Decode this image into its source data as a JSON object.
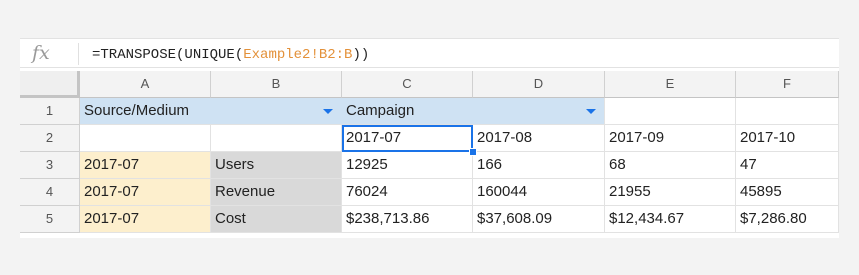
{
  "formula_bar": {
    "fx_label": "fx",
    "formula_prefix": "=TRANSPOSE(UNIQUE(",
    "formula_ref": "Example2!B2:B",
    "formula_suffix": "))"
  },
  "columns": [
    "A",
    "B",
    "C",
    "D",
    "E",
    "F"
  ],
  "rows": [
    {
      "num": "1",
      "cells": [
        "Source/Medium",
        "",
        "Campaign",
        "",
        "",
        ""
      ]
    },
    {
      "num": "2",
      "cells": [
        "",
        "",
        "2017-07",
        "2017-08",
        "2017-09",
        "2017-10"
      ]
    },
    {
      "num": "3",
      "cells": [
        "2017-07",
        "Users",
        "12925",
        "166",
        "68",
        "47"
      ]
    },
    {
      "num": "4",
      "cells": [
        "2017-07",
        "Revenue",
        "76024",
        "160044",
        "21955",
        "45895"
      ]
    },
    {
      "num": "5",
      "cells": [
        "2017-07",
        "Cost",
        "$238,713.86",
        "$37,608.09",
        "$12,434.67",
        "$7,286.80"
      ]
    }
  ],
  "colors": {
    "header_fill": "#cfe2f3",
    "date_fill": "#fdefcd",
    "metric_fill": "#d9d9d9",
    "selection": "#1a73e8",
    "formula_ref": "#e3913a"
  }
}
